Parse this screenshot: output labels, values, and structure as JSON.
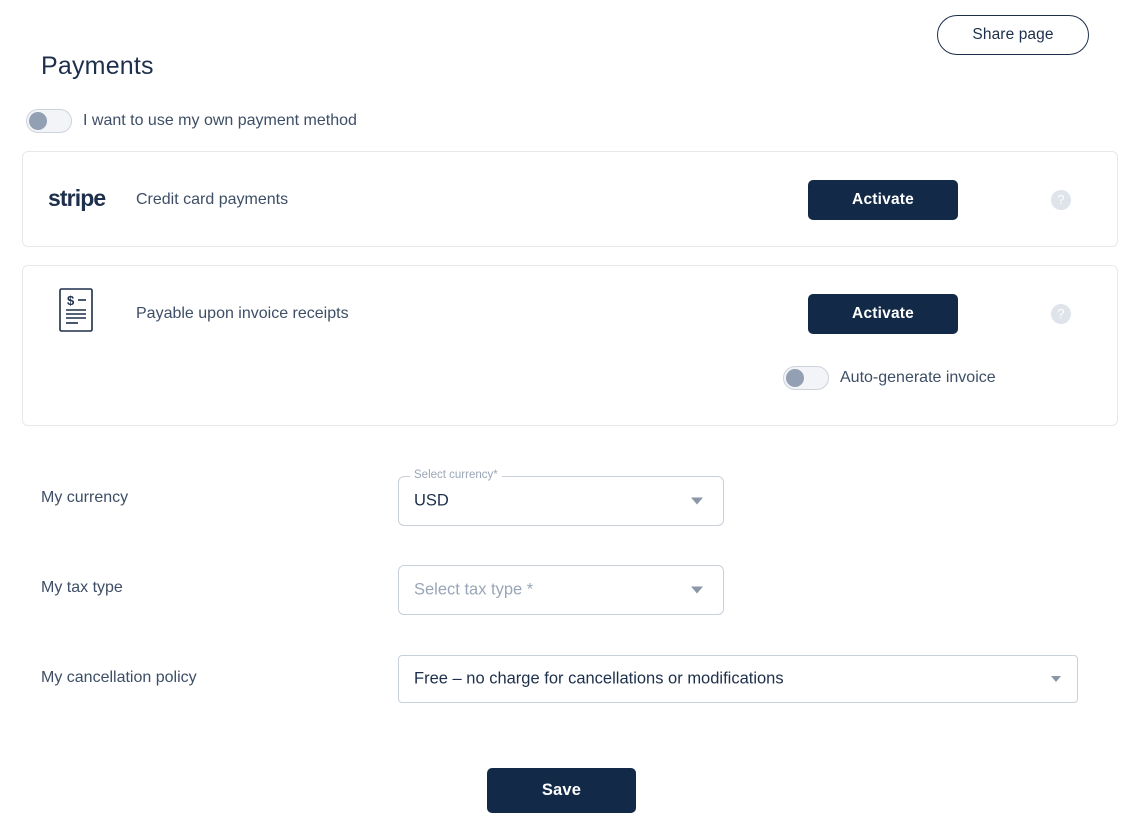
{
  "header": {
    "title": "Payments",
    "share_button": "Share page"
  },
  "own_method_toggle": {
    "label": "I want to use my own payment method",
    "state": "off"
  },
  "cards": [
    {
      "id": "stripe",
      "logo": "stripe",
      "title": "Credit card payments",
      "activate_label": "Activate",
      "help_glyph": "?"
    },
    {
      "id": "invoice",
      "icon": "invoice-document-icon",
      "title": "Payable upon invoice receipts",
      "activate_label": "Activate",
      "help_glyph": "?",
      "auto_toggle": {
        "label": "Auto-generate invoice",
        "state": "off"
      }
    }
  ],
  "form": {
    "currency": {
      "label": "My currency",
      "notch_label": "Select currency*",
      "value": "USD"
    },
    "tax_type": {
      "label": "My tax type",
      "placeholder": "Select tax type *",
      "value": ""
    },
    "cancellation_policy": {
      "label": "My cancellation policy",
      "value": "Free – no charge for cancellations or modifications"
    }
  },
  "footer": {
    "save_label": "Save"
  },
  "colors": {
    "primary_dark": "#122948",
    "text_navy": "#1d2f4b",
    "text_body": "#3d4e66",
    "muted": "#9aa6b7",
    "border": "#c9d0da",
    "card_border": "#e6e8ec"
  }
}
